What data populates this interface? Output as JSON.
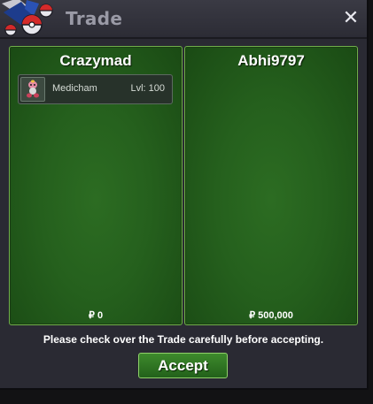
{
  "window": {
    "title": "Trade",
    "close_symbol": "✕",
    "logo_icon": "pokeball-logo-icon"
  },
  "trade": {
    "left": {
      "player": "Crazymad",
      "items": [
        {
          "name": "Medicham",
          "level": "Lvl: 100",
          "icon": "medicham-sprite-icon"
        }
      ],
      "money": "₽ 0"
    },
    "right": {
      "player": "Abhi9797",
      "items": [],
      "money": "₽ 500,000"
    }
  },
  "footer": {
    "notice": "Please check over the Trade carefully before accepting.",
    "accept_label": "Accept"
  },
  "colors": {
    "panel_green": "#25601d",
    "panel_border": "#6fae4a",
    "accept_green": "#2f7a22",
    "window_bg": "#2a2a33"
  }
}
